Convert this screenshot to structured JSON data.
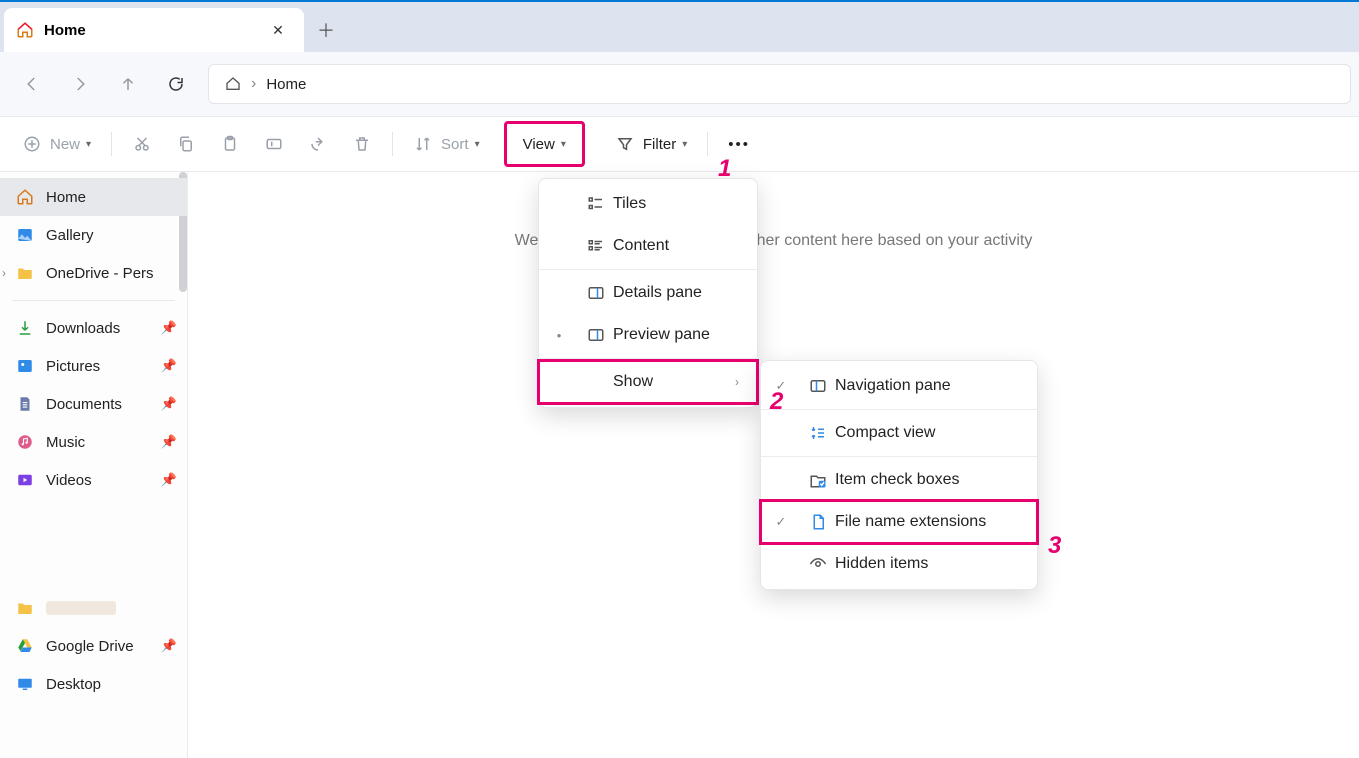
{
  "window": {
    "tab_title": "Home",
    "breadcrumb": {
      "root_icon": "home",
      "location": "Home"
    }
  },
  "toolbar": {
    "new_label": "New",
    "sort_label": "Sort",
    "view_label": "View",
    "filter_label": "Filter"
  },
  "sidebar": {
    "items": [
      {
        "id": "home",
        "label": "Home",
        "icon": "home",
        "active": true
      },
      {
        "id": "gallery",
        "label": "Gallery",
        "icon": "gallery"
      },
      {
        "id": "onedrive",
        "label": "OneDrive - Pers",
        "icon": "folder",
        "expandable": true
      },
      {
        "id": "downloads",
        "label": "Downloads",
        "icon": "download",
        "pinned": true
      },
      {
        "id": "pictures",
        "label": "Pictures",
        "icon": "gallery",
        "pinned": true
      },
      {
        "id": "documents",
        "label": "Documents",
        "icon": "doc",
        "pinned": true
      },
      {
        "id": "music",
        "label": "Music",
        "icon": "music",
        "pinned": true
      },
      {
        "id": "videos",
        "label": "Videos",
        "icon": "video",
        "pinned": true
      },
      {
        "id": "gdrive",
        "label": "Google Drive",
        "icon": "gdrive",
        "pinned": true
      },
      {
        "id": "desktop",
        "label": "Desktop",
        "icon": "desktop"
      }
    ]
  },
  "content": {
    "empty_message": "We'll show your recent files and other content here based on your activity"
  },
  "view_menu": {
    "items": [
      {
        "id": "tiles",
        "label": "Tiles",
        "icon": "tiles"
      },
      {
        "id": "content",
        "label": "Content",
        "icon": "content"
      },
      {
        "id": "details",
        "label": "Details pane",
        "icon": "pane-r"
      },
      {
        "id": "preview",
        "label": "Preview pane",
        "icon": "pane-r",
        "bullet": true
      },
      {
        "id": "show",
        "label": "Show",
        "submenu": true,
        "highlight": true
      }
    ]
  },
  "show_menu": {
    "items": [
      {
        "id": "navpane",
        "label": "Navigation pane",
        "icon": "pane-l",
        "checked": true
      },
      {
        "id": "compact",
        "label": "Compact view",
        "icon": "compact"
      },
      {
        "id": "checkboxes",
        "label": "Item check boxes",
        "icon": "checkbox"
      },
      {
        "id": "extensions",
        "label": "File name extensions",
        "icon": "file",
        "checked": true,
        "highlight": true
      },
      {
        "id": "hidden",
        "label": "Hidden items",
        "icon": "eye"
      }
    ]
  },
  "annotations": {
    "n1": "1",
    "n2": "2",
    "n3": "3"
  }
}
